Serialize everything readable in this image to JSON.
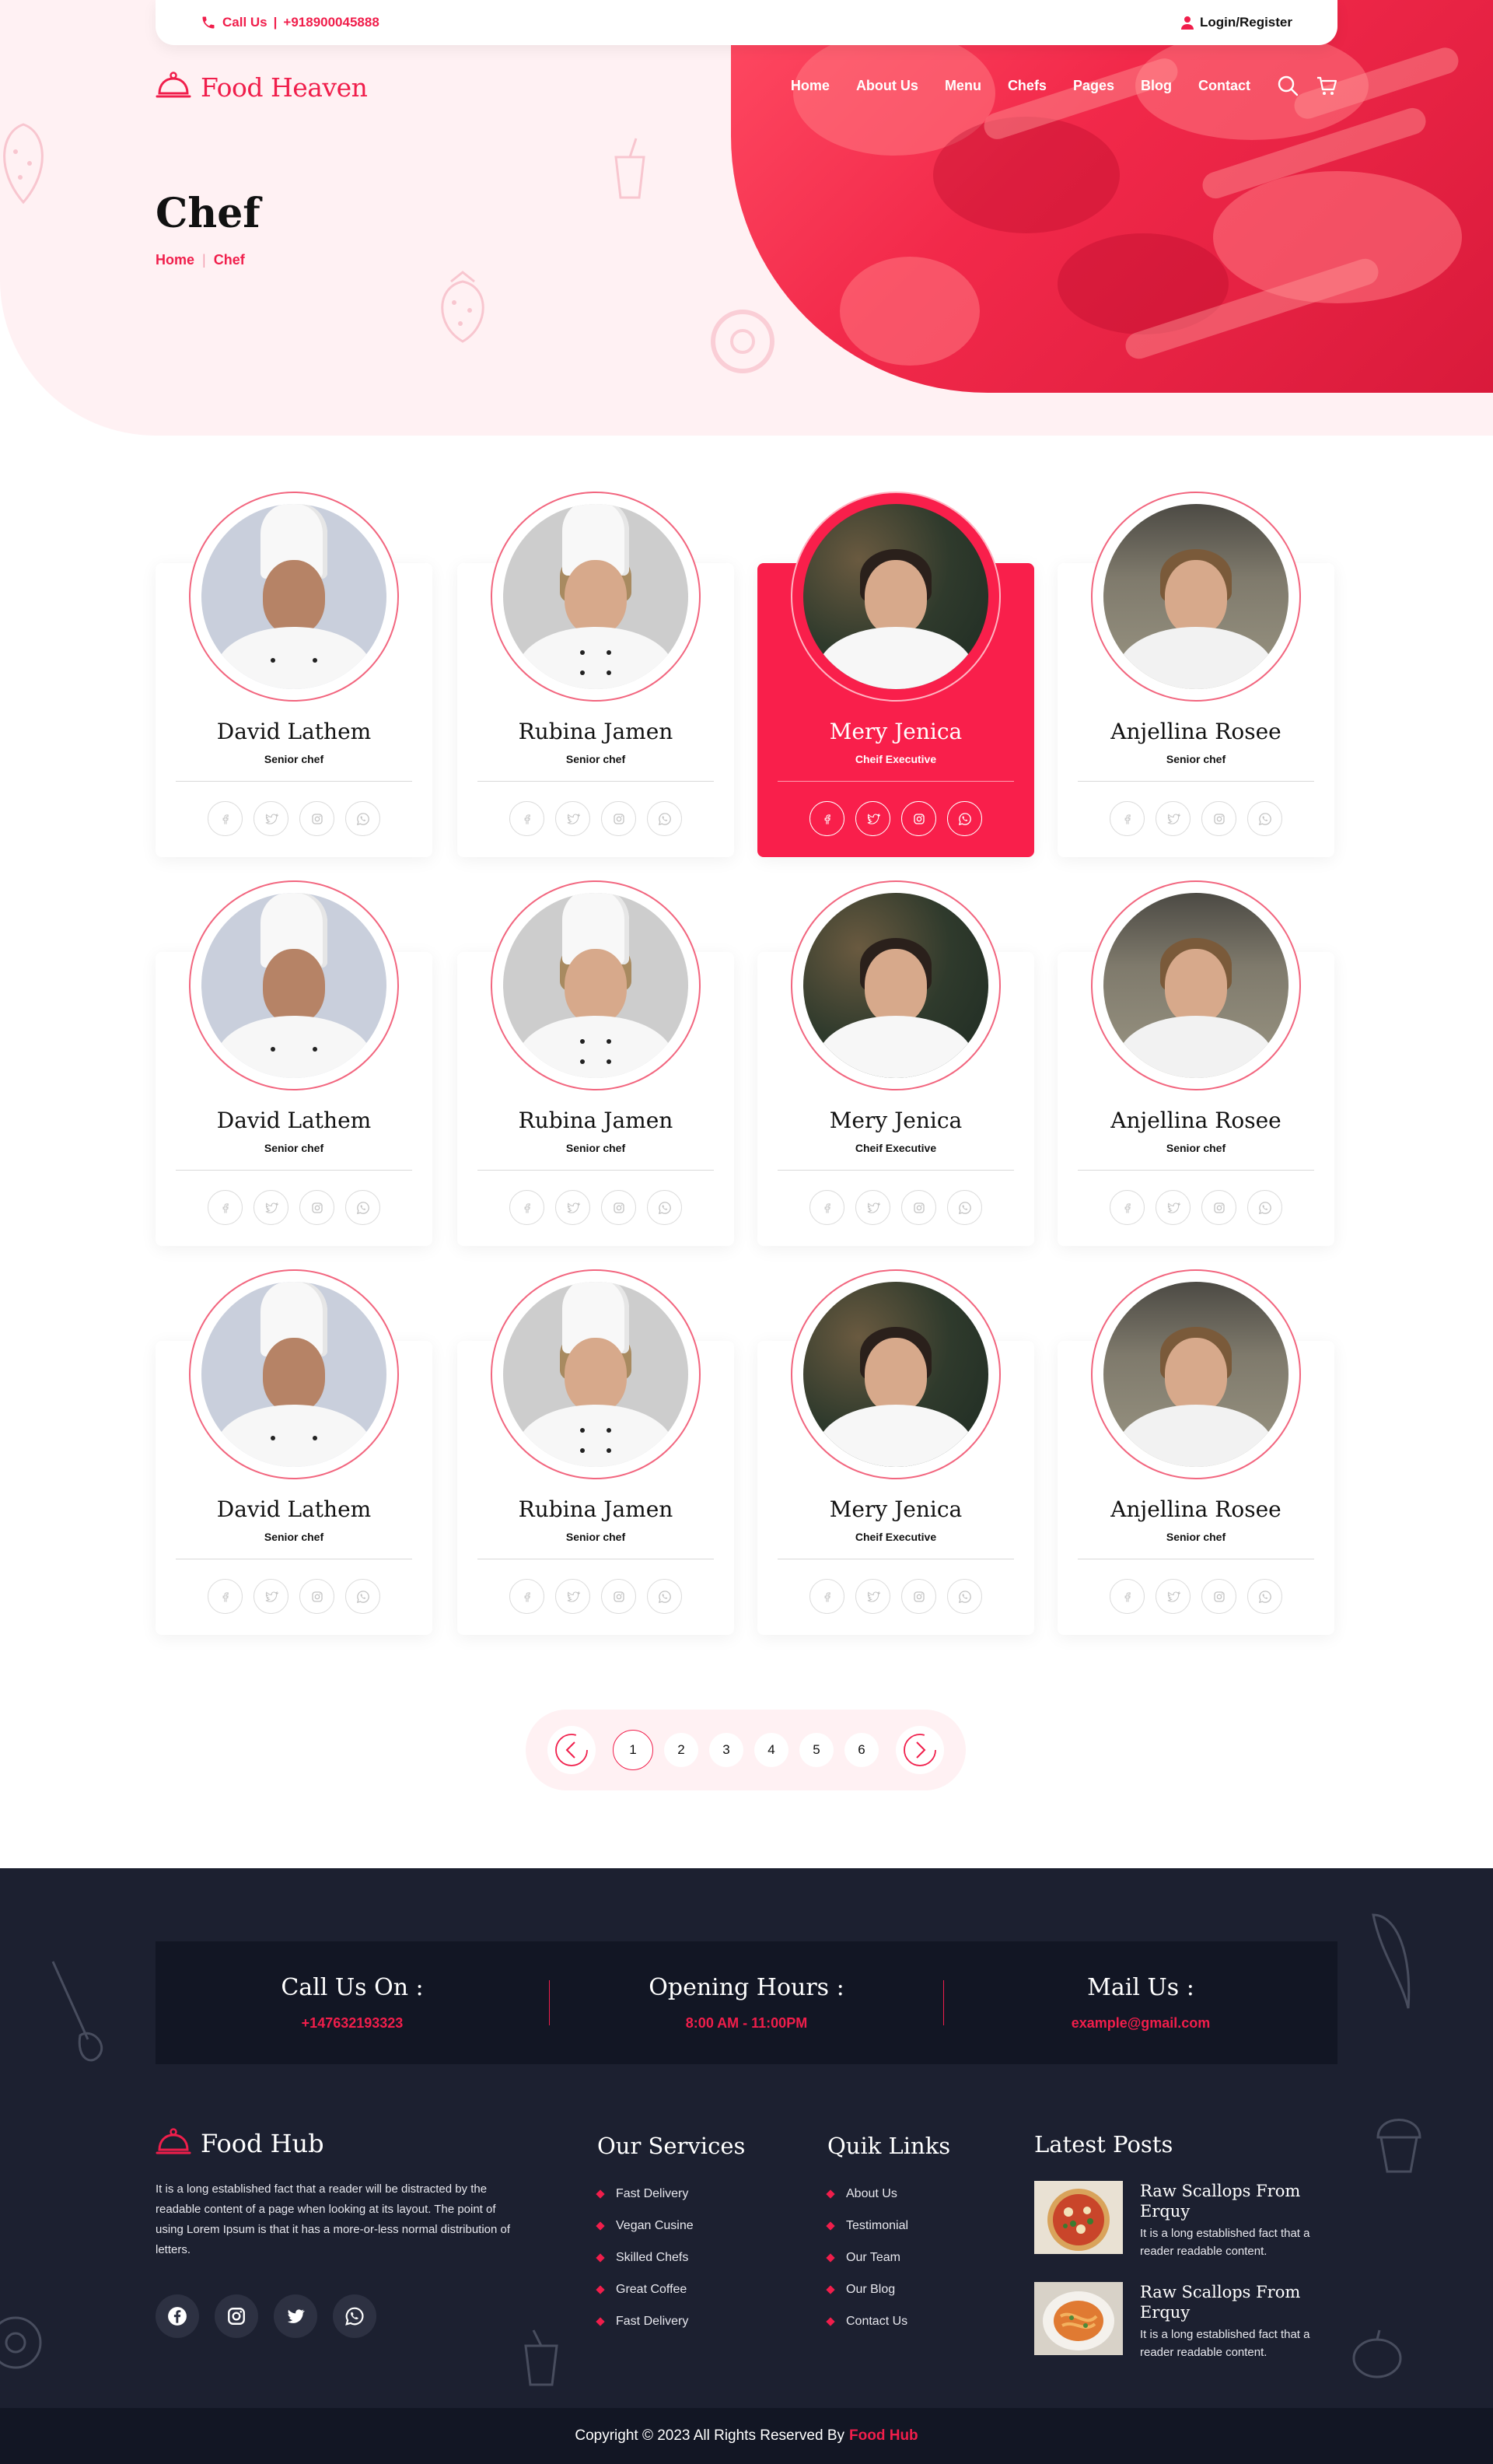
{
  "topbar": {
    "call_label": "Call Us",
    "divider": "|",
    "phone": "+918900045888",
    "login": "Login/Register"
  },
  "brand": {
    "name": "Food Heaven",
    "color": "#f01e4b"
  },
  "nav": {
    "items": [
      {
        "label": "Home"
      },
      {
        "label": "About Us"
      },
      {
        "label": "Menu"
      },
      {
        "label": "Chefs"
      },
      {
        "label": "Pages"
      },
      {
        "label": "Blog"
      },
      {
        "label": "Contact"
      }
    ],
    "icons": [
      "search-icon",
      "cart-icon"
    ]
  },
  "hero": {
    "title": "Chef",
    "breadcrumb": [
      "Home",
      "Chef"
    ],
    "breadcrumb_separator": "|"
  },
  "chefs": [
    {
      "name": "David Lathem",
      "role": "Senior chef"
    },
    {
      "name": "Rubina Jamen",
      "role": "Senior chef"
    },
    {
      "name": "Mery Jenica",
      "role": "Cheif Executive"
    },
    {
      "name": "Anjellina Rosee",
      "role": "Senior chef"
    },
    {
      "name": "David Lathem",
      "role": "Senior chef"
    },
    {
      "name": "Rubina Jamen",
      "role": "Senior chef"
    },
    {
      "name": "Mery Jenica",
      "role": "Cheif Executive"
    },
    {
      "name": "Anjellina Rosee",
      "role": "Senior chef"
    },
    {
      "name": "David Lathem",
      "role": "Senior chef"
    },
    {
      "name": "Rubina Jamen",
      "role": "Senior chef"
    },
    {
      "name": "Mery Jenica",
      "role": "Cheif Executive"
    },
    {
      "name": "Anjellina Rosee",
      "role": "Senior chef"
    }
  ],
  "chef_social_icons": [
    "facebook-icon",
    "twitter-icon",
    "instagram-icon",
    "whatsapp-icon"
  ],
  "active_chef_index": 2,
  "pagination": {
    "pages": [
      "1",
      "2",
      "3",
      "4",
      "5",
      "6"
    ],
    "current": "1"
  },
  "footer": {
    "contact": [
      {
        "heading": "Call Us On :",
        "value": "+147632193323"
      },
      {
        "heading": "Opening Hours :",
        "value": "8:00 AM - 11:00PM"
      },
      {
        "heading": "Mail Us :",
        "value": "example@gmail.com"
      }
    ],
    "brand": "Food Hub",
    "about": "It is a long established fact that a reader will be distracted by the readable content of a page when looking at its layout. The point of using Lorem Ipsum is that it has a more-or-less normal distribution of letters.",
    "social_icons": [
      "facebook-icon",
      "instagram-icon",
      "twitter-icon",
      "whatsapp-icon"
    ],
    "services": {
      "title": "Our Services",
      "items": [
        "Fast Delivery",
        "Vegan Cusine",
        "Skilled Chefs",
        "Great Coffee",
        "Fast Delivery"
      ]
    },
    "links": {
      "title": "Quik Links",
      "items": [
        "About Us",
        "Testimonial",
        "Our Team",
        "Our Blog",
        "Contact Us"
      ]
    },
    "posts": {
      "title": "Latest Posts",
      "items": [
        {
          "title": "Raw Scallops From Erquy",
          "excerpt": "It is a long established fact that a reader readable content."
        },
        {
          "title": "Raw Scallops From Erquy",
          "excerpt": "It is a long established fact that a reader readable content."
        }
      ]
    },
    "copyright_prefix": "Copyright © 2023 All Rights Reserved By",
    "copyright_brand": "Food Hub"
  }
}
